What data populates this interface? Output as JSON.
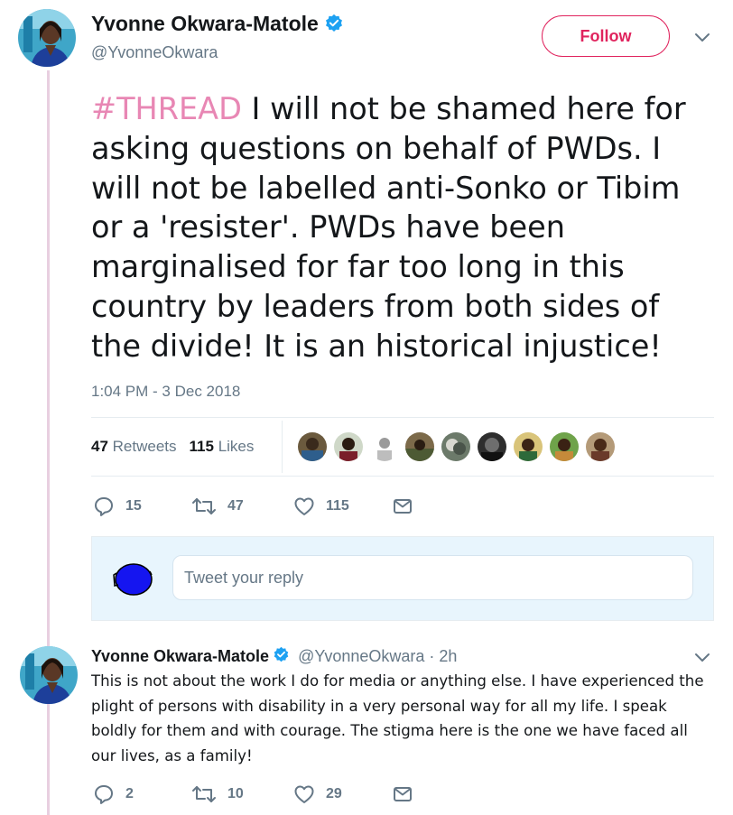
{
  "main_tweet": {
    "author_name": "Yvonne Okwara-Matole",
    "handle": "@YvonneOkwara",
    "follow_label": "Follow",
    "hashtag": "#THREAD",
    "text": " I will not be shamed here for asking questions on behalf of PWDs.  I will not be labelled anti-Sonko or Tibim or a 'resister'.  PWDs have been marginalised for far too long in this country by leaders from both sides of the divide!  It is an historical injustice!",
    "timestamp": "1:04 PM - 3 Dec 2018",
    "retweets_count": "47",
    "retweets_label": "Retweets",
    "likes_count": "115",
    "likes_label": "Likes",
    "actions": {
      "reply_count": "15",
      "retweet_count": "47",
      "like_count": "115"
    }
  },
  "reply_box": {
    "placeholder": "Tweet your reply"
  },
  "reply_tweet": {
    "author_name": "Yvonne Okwara-Matole",
    "meta": "@YvonneOkwara · 2h",
    "text": "This is not about the work I do for media or anything else.  I have experienced the plight of persons with disability in a very personal way for all my life.  I speak boldly for them and with courage.  The stigma here is the one we have faced all our lives, as a family!",
    "actions": {
      "reply_count": "2",
      "retweet_count": "10",
      "like_count": "29"
    }
  },
  "colors": {
    "accent": "#e0245e",
    "hashtag": "#e887b4",
    "verified": "#1da1f2",
    "muted": "#657786",
    "thread_line": "#e8cfe0"
  },
  "icons": [
    "verified-badge-icon",
    "chevron-down-icon",
    "reply-icon",
    "retweet-icon",
    "like-icon",
    "message-icon"
  ]
}
